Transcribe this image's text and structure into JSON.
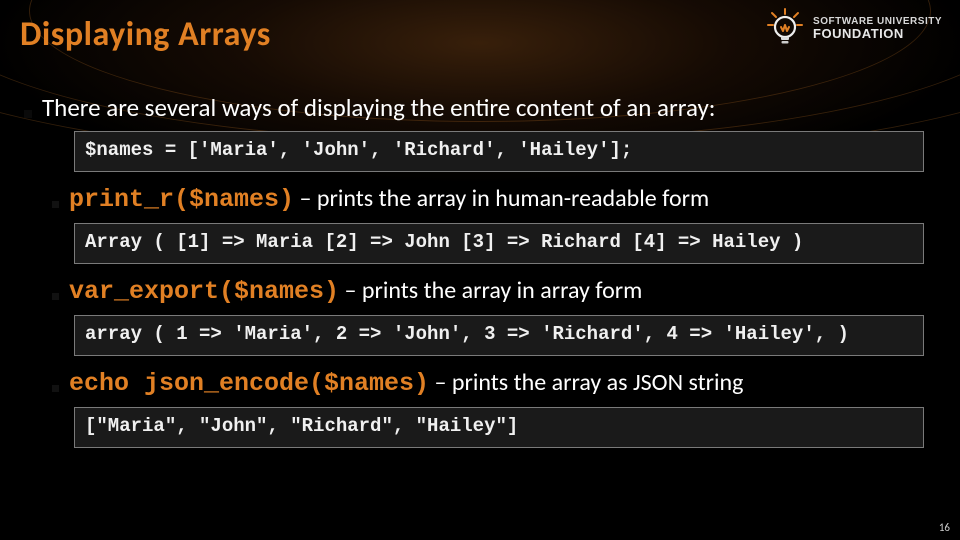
{
  "logo": {
    "line1": "SOFTWARE UNIVERSITY",
    "line2": "FOUNDATION"
  },
  "title": "Displaying Arrays",
  "main_bullet": "There are several ways of displaying the entire content of an array:",
  "code1": "$names = ['Maria', 'John', 'Richard', 'Hailey'];",
  "fn1": {
    "code": "print_r($names)",
    "desc": " – prints the array in human-readable form"
  },
  "out1": "Array ( [1] => Maria [2] => John [3] => Richard [4] => Hailey )",
  "fn2": {
    "code": "var_export($names)",
    "desc": " – prints the array in array form"
  },
  "out2": "array ( 1 => 'Maria', 2 => 'John', 3 => 'Richard', 4 => 'Hailey', )",
  "fn3": {
    "code": "echo json_encode($names)",
    "desc": " – prints the array as JSON string"
  },
  "out3": "[\"Maria\", \"John\", \"Richard\", \"Hailey\"]",
  "page": "16"
}
